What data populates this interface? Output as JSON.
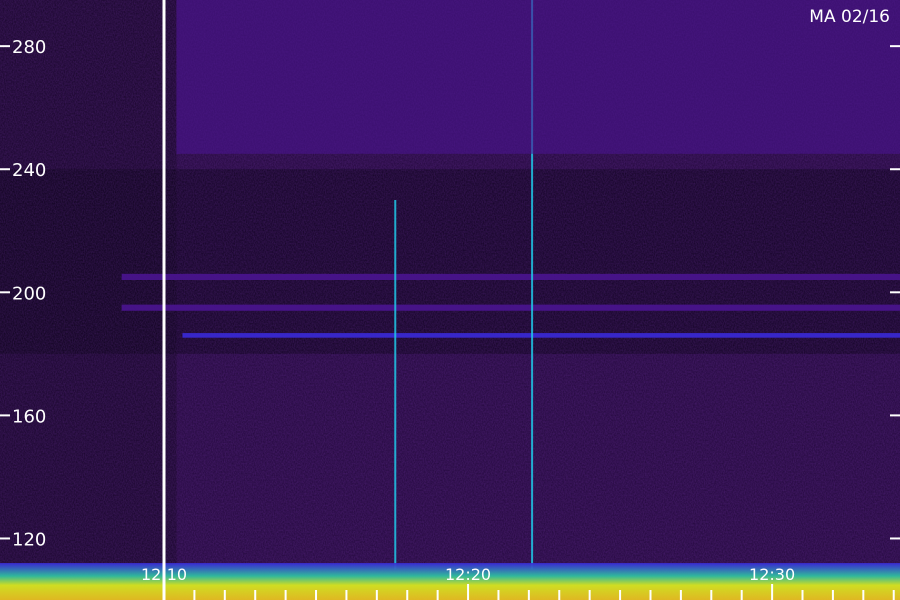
{
  "chart_data": {
    "type": "heatmap",
    "title": "",
    "xlabel": "",
    "ylabel": "",
    "station_label": "MA 02/16",
    "y_range": [
      100,
      295
    ],
    "y_ticks": [
      120,
      160,
      200,
      240,
      280
    ],
    "y_tick_labels": [
      "120",
      "160",
      "200",
      "240",
      "280"
    ],
    "x_time_labels": [
      "12:10",
      "12:20",
      "12:30"
    ],
    "x_range_minutes": [
      0,
      29.6
    ],
    "time_label_positions_minutes": [
      0,
      10,
      20
    ],
    "colors": {
      "background": "#000000",
      "noise_floor": "#2a0a4a",
      "low": "#4a1490",
      "mid": "#3a2ad8",
      "cyan": "#20c8e8",
      "green": "#40e040",
      "yellow": "#e8f020",
      "white_line": "#ffffff"
    },
    "features": [
      {
        "name": "horizontal-band",
        "y_center": 186,
        "y_width": 1.5,
        "t_start": 6,
        "t_end": 29.6,
        "level": "blue"
      },
      {
        "name": "horizontal-band",
        "y_center": 195,
        "y_width": 2,
        "t_start": 4,
        "t_end": 29.6,
        "level": "purple"
      },
      {
        "name": "horizontal-band",
        "y_center": 205,
        "y_width": 2,
        "t_start": 4,
        "t_end": 29.6,
        "level": "purple"
      },
      {
        "name": "bright-spike",
        "t": 13,
        "y_start": 110,
        "y_end": 230
      },
      {
        "name": "bright-spike",
        "t": 17.5,
        "y_start": 110,
        "y_end": 295
      },
      {
        "name": "broadband-low-strip",
        "y_start": 100,
        "y_end": 112,
        "t_start": 0,
        "t_end": 29.6,
        "level": "green-yellow"
      },
      {
        "name": "upper-purple-region",
        "y_start": 245,
        "y_end": 295,
        "t_start": 5.8,
        "t_end": 29.6,
        "level": "purple"
      }
    ]
  }
}
